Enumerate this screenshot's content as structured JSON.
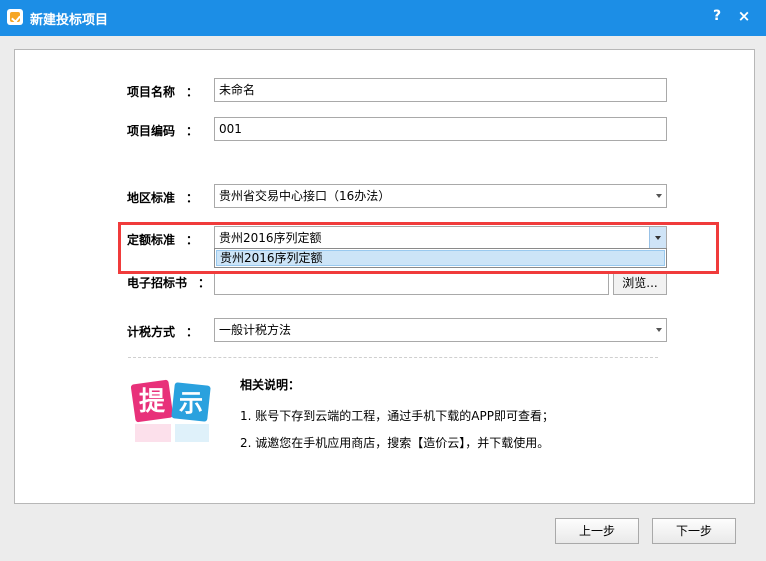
{
  "window": {
    "title": "新建投标项目",
    "help_label": "?",
    "close_label": "×"
  },
  "form": {
    "project_name": {
      "label": "项目名称",
      "colon": "：",
      "value": "未命名"
    },
    "project_code": {
      "label": "项目编码",
      "colon": "：",
      "value": "001"
    },
    "region_standard": {
      "label": "地区标准",
      "colon": "：",
      "value": "贵州省交易中心接口（16办法）"
    },
    "quota_standard": {
      "label": "定额标准",
      "colon": "：",
      "value": "贵州2016序列定额",
      "options": [
        "贵州2016序列定额"
      ]
    },
    "tender_file": {
      "label": "电子招标书",
      "colon": "：",
      "value": "",
      "browse_label": "浏览..."
    },
    "tax_method": {
      "label": "计税方式",
      "colon": "：",
      "value": "一般计税方法"
    }
  },
  "tip": {
    "icon_char_1": "提",
    "icon_char_2": "示"
  },
  "notes": {
    "title": "相关说明：",
    "items": [
      "1. 账号下存到云端的工程，通过手机下载的APP即可查看；",
      "2. 诚邀您在手机应用商店，搜索【造价云】，并下载使用。"
    ]
  },
  "buttons": {
    "prev": "上一步",
    "next": "下一步"
  },
  "colors": {
    "titlebar": "#1c8ee6",
    "highlight": "#f03b3b",
    "tip_pink": "#e8317a",
    "tip_blue": "#2aa1de"
  }
}
